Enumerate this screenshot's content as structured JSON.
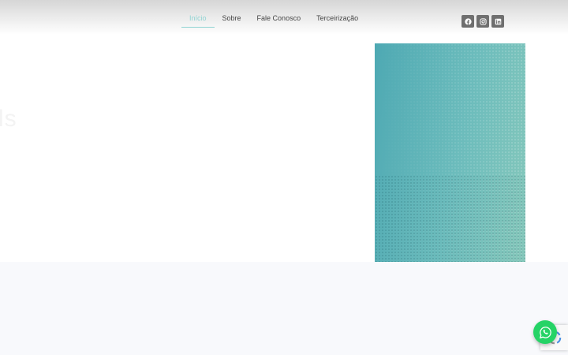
{
  "nav": {
    "items": [
      {
        "label": "Início",
        "active": true
      },
      {
        "label": "Sobre",
        "active": false
      },
      {
        "label": "Fale Conosco",
        "active": false
      },
      {
        "label": "Terceirização",
        "active": false
      }
    ],
    "active_color": "#8fd3d2"
  },
  "social": {
    "icons": [
      "facebook-icon",
      "instagram-icon",
      "linkedin-icon"
    ],
    "color": "#6f6f6f"
  },
  "hero": {
    "ghost_text": "ls",
    "panel_colors": [
      "#4ea9b3",
      "#86c8bb"
    ]
  },
  "floating": {
    "whatsapp_color": "#25d366",
    "icons": [
      "whatsapp-icon",
      "recaptcha-icon"
    ]
  }
}
